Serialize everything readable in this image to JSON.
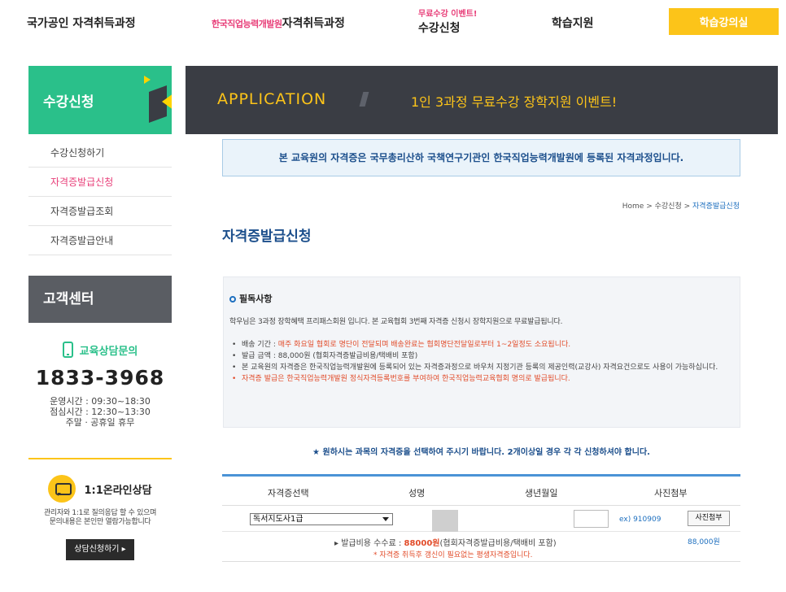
{
  "nav": {
    "item1": "국가공인 자격취득과정",
    "item2_brand": "한국직업능력개발원",
    "item2_text": "자격취득과정",
    "item3_promo": "무료수강 이벤트!",
    "item3_text": "수강신청",
    "item4": "학습지원",
    "study_button": "학습강의실"
  },
  "sidebar": {
    "title": "수강신청",
    "items": [
      {
        "label": "수강신청하기"
      },
      {
        "label": "자격증발급신청"
      },
      {
        "label": "자격증발급조회"
      },
      {
        "label": "자격증발급안내"
      }
    ],
    "cs_title": "고객센터",
    "consult_label": "교육상담문의",
    "phone": "1833-3968",
    "hours1": "운영시간 : 09:30~18:30",
    "hours2": "점심시간 : 12:30~13:30",
    "hours3": "주말 · 공휴일 휴무",
    "online_label": "1:1온라인상담",
    "online_desc1": "관리자와 1:1로 질의응답 할 수 있으며",
    "online_desc2": "문의내용은 본인만 열람가능합니다",
    "online_button": "상담신청하기 ▸"
  },
  "banner": {
    "title": "APPLICATION",
    "event": "1인 3과정 무료수강 장학지원 이벤트!"
  },
  "notice": "본 교육원의 자격증은 국무총리산하 국책연구기관인 한국직업능력개발원에 등록된 자격과정입니다.",
  "breadcrumb": {
    "home": "Home",
    "sep": ">",
    "section": "수강신청",
    "current": "자격증발급신청"
  },
  "page_title": "자격증발급신청",
  "info": {
    "heading": "필독사항",
    "intro": "학우님은 3과정 장학혜택 프리패스회원 입니다. 본 교육협회 3번째 자격증 신청시 장학지원으로 무료발급됩니다.",
    "b1_label": "배송 기간 : ",
    "b1_red": "매주 화요일 협회로 명단이 전달되며 배송완료는 협회명단전달일로부터 1~2일정도 소요됩니다.",
    "b2": "발급 금액 : 88,000원 (협회자격증발급비용/택배비 포함)",
    "b3": "본 교육원의 자격증은 한국직업능력개발원에 등록되어 있는 자격증과정으로 바우처 지정기관 등록의 제공인력(교강사) 자격요건으로도 사용이 가능하십니다.",
    "b4": "자격증 발급은 한국직업능력개발원 정식자격등록번호를 부여하여 한국직업능력교육협회 명의로 발급됩니다."
  },
  "guide": "★ 원하시는 과목의 자격증을 선택하여 주시기 바랍니다. 2개이상일 경우 각 각 신청하셔야 합니다.",
  "table": {
    "headers": [
      "자격증선택",
      "성명",
      "생년월일",
      "사진첨부"
    ],
    "selected": "독서지도사1급",
    "birth_example": "ex) 910909",
    "photo_button": "사진첨부",
    "fee_prefix": "▸ 발급비용 수수료 : ",
    "fee_value": "88000원",
    "fee_suffix": "(협회자격증발급비용/택배비 포함)",
    "fee_note": "* 자격증 취득후 갱신이 필요없는 평생자격증입니다.",
    "fee_amount": "88,000원"
  }
}
